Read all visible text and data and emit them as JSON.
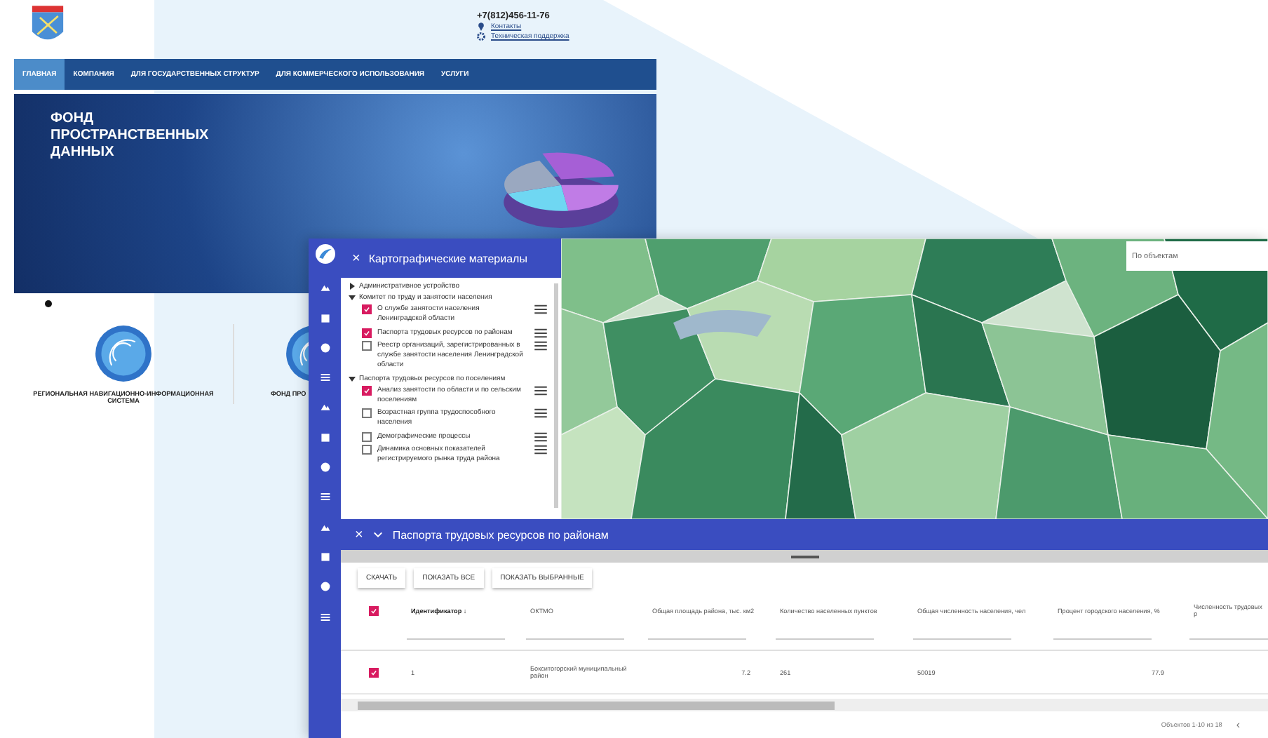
{
  "website": {
    "contacts": {
      "phone": "+7(812)456-11-76",
      "links": [
        "Контакты",
        "Техническая поддержка"
      ]
    },
    "nav": [
      {
        "label": "ГЛАВНАЯ",
        "selected": true
      },
      {
        "label": "КОМПАНИЯ",
        "selected": false
      },
      {
        "label": "ДЛЯ ГОСУДАРСТВЕННЫХ СТРУКТУР",
        "selected": false
      },
      {
        "label": "ДЛЯ КОММЕРЧЕСКОГО ИСПОЛЬЗОВАНИЯ",
        "selected": false
      },
      {
        "label": "УСЛУГИ",
        "selected": false
      }
    ],
    "banner": {
      "title": "ФОНД ПРОСТРАНСТВЕННЫХ ДАННЫХ"
    },
    "projects": [
      {
        "label": "РЕГИОНАЛЬНАЯ НАВИГАЦИОННО-ИНФОРМАЦИОННАЯ СИСТЕМА"
      },
      {
        "label": "ФОНД ПРО"
      }
    ]
  },
  "map_app": {
    "layers_panel": {
      "close": "×",
      "title": "Картографические материалы",
      "tree": [
        {
          "label": "Административное устройство",
          "expanded": false
        },
        {
          "label": "Комитет по труду и занятости населения",
          "expanded": true,
          "children": [
            {
              "label": "О службе занятости населения Ленинградской области",
              "checked": true
            },
            {
              "label": "Паспорта трудовых ресурсов по районам",
              "checked": true
            },
            {
              "label": "Реестр организаций, зарегистрированных в службе занятости населения Ленинградской области",
              "checked": false
            }
          ]
        },
        {
          "label": "Паспорта трудовых ресурсов по поселениям",
          "expanded": true,
          "children": [
            {
              "label": "Анализ занятости по области и по сельским поселениям",
              "checked": true
            },
            {
              "label": "Возрастная группа трудоспособного населения",
              "checked": false
            },
            {
              "label": "Демографические процессы",
              "checked": false
            },
            {
              "label": "Динамика основных показателей регистрируемого рынка труда района",
              "checked": false
            }
          ]
        }
      ]
    },
    "search": {
      "placeholder": "По объектам"
    },
    "table_panel": {
      "close": "×",
      "title": "Паспорта трудовых ресурсов по районам",
      "buttons": [
        "СКАЧАТЬ",
        "ПОКАЗАТЬ ВСЕ",
        "ПОКАЗАТЬ ВЫБРАННЫЕ"
      ],
      "select_all": {
        "checked": true
      },
      "columns": [
        "Идентификатор ↓",
        "ОКТМО",
        "Общая площадь района, тыс. км2",
        "Количество населенных пунктов",
        "Общая численность населения, чел",
        "Процент городского населения, %",
        "Численность трудовых р"
      ],
      "rows": [
        {
          "checked": true,
          "cells": [
            "1",
            "Бокситогорский муниципальный район",
            "7.2",
            "261",
            "50019",
            "77.9",
            ""
          ]
        }
      ],
      "pagination": "Объектов 1-10 из 18",
      "prev": "‹"
    }
  }
}
